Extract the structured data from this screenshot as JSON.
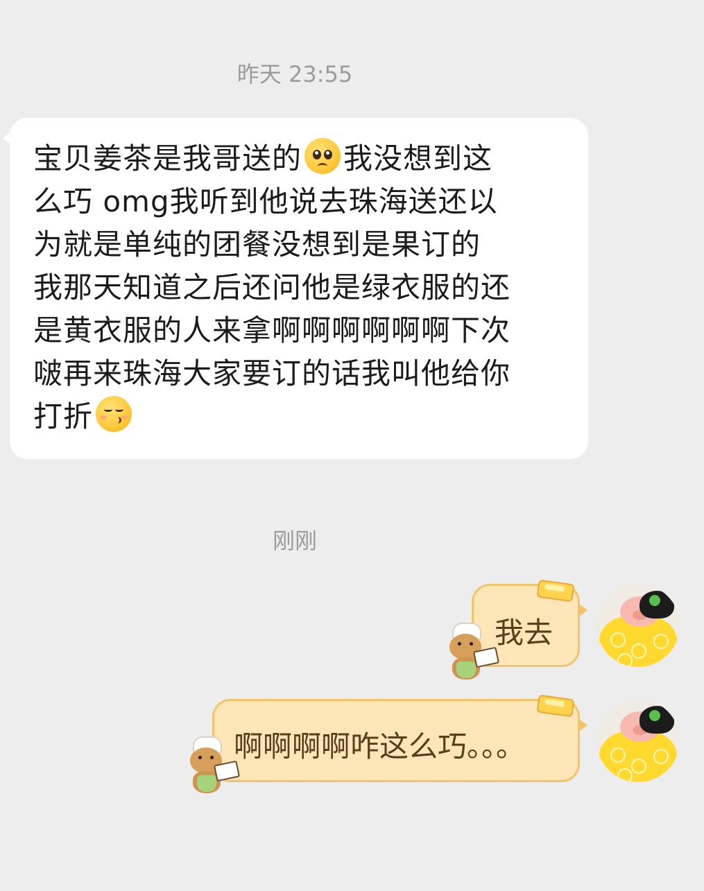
{
  "chat": {
    "timestamp_1": "昨天 23:55",
    "timestamp_2": "刚刚",
    "incoming": {
      "lines": [
        {
          "before": "宝贝姜茶是我哥送的",
          "emoji": "pleading-face-emoji",
          "after": "我没想到这"
        },
        {
          "text": "么巧 omg我听到他说去珠海送还以"
        },
        {
          "text": "为就是单纯的团餐没想到是果订的"
        },
        {
          "text": "我那天知道之后还问他是绿衣服的还"
        },
        {
          "text": "是黄衣服的人来拿啊啊啊啊啊啊下次"
        },
        {
          "text": "啵再来珠海大家要订的话我叫他给你"
        },
        {
          "before": "打折",
          "emoji": "kissing-smiling-eyes-emoji"
        }
      ]
    },
    "outgoing": [
      {
        "text": "我去",
        "sticker": "teddy-chef-sticker",
        "avatar": "pig-avatar"
      },
      {
        "text": "啊啊啊啊咋这么巧。。。",
        "sticker": "teddy-chef-sticker",
        "avatar": "pig-avatar"
      }
    ]
  },
  "colors": {
    "background": "#ededed",
    "incoming_bubble": "#ffffff",
    "outgoing_bubble": "#fce6b7",
    "outgoing_border": "#f2c46a",
    "outgoing_text": "#5a3d1a",
    "timestamp_text": "#9b9b9b"
  }
}
